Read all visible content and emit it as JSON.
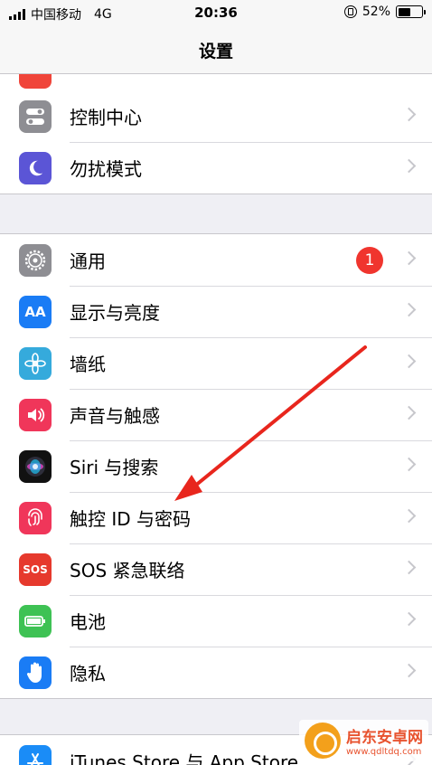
{
  "status": {
    "carrier": "中国移动",
    "network": "4G",
    "time": "20:36",
    "battery_pct": "52%",
    "battery_level": 0.52
  },
  "nav": {
    "title": "设置"
  },
  "group1": [
    {
      "label": "控制中心",
      "icon": "control-center-icon",
      "color": "#8e8e93"
    },
    {
      "label": "勿扰模式",
      "icon": "moon-icon",
      "color": "#5b55d6"
    }
  ],
  "group2": [
    {
      "label": "通用",
      "icon": "gear-icon",
      "color": "#8e8e93",
      "badge": "1"
    },
    {
      "label": "显示与亮度",
      "icon": "display-aa-icon",
      "color": "#1a7cf5",
      "glyph": "AA"
    },
    {
      "label": "墙纸",
      "icon": "wallpaper-flower-icon",
      "color": "#35aadc"
    },
    {
      "label": "声音与触感",
      "icon": "speaker-icon",
      "color": "#f0365a"
    },
    {
      "label": "Siri 与搜索",
      "icon": "siri-icon",
      "color": "#111111"
    },
    {
      "label": "触控 ID 与密码",
      "icon": "fingerprint-icon",
      "color": "#f0365a"
    },
    {
      "label": "SOS 紧急联络",
      "icon": "sos-icon",
      "color": "#e6392d",
      "glyph": "SOS"
    },
    {
      "label": "电池",
      "icon": "battery-icon",
      "color": "#3ec254"
    },
    {
      "label": "隐私",
      "icon": "hand-icon",
      "color": "#1a7cf5"
    }
  ],
  "group3": [
    {
      "label": "iTunes Store 与 App Store",
      "icon": "app-store-icon",
      "color": "#1a8cf7"
    }
  ],
  "watermark": {
    "name": "启东安卓网",
    "url": "www.qdltdq.com"
  }
}
